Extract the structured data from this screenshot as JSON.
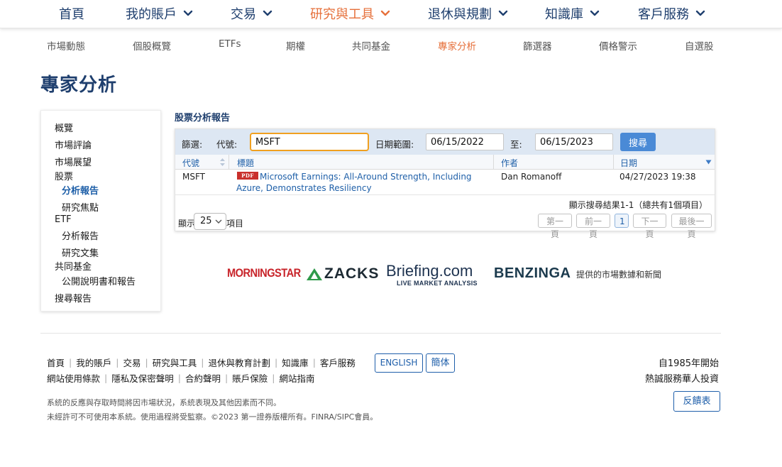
{
  "top_nav": [
    {
      "label": "首頁",
      "has_menu": false
    },
    {
      "label": "我的賬戶",
      "has_menu": true
    },
    {
      "label": "交易",
      "has_menu": true
    },
    {
      "label": "研究與工具",
      "has_menu": true,
      "active": true
    },
    {
      "label": "退休與規劃",
      "has_menu": true
    },
    {
      "label": "知識庫",
      "has_menu": true
    },
    {
      "label": "客戶服務",
      "has_menu": true
    }
  ],
  "sub_nav": [
    {
      "label": "市場動態"
    },
    {
      "label": "個股概覽"
    },
    {
      "label": "ETFs"
    },
    {
      "label": "期權"
    },
    {
      "label": "共同基金"
    },
    {
      "label": "專家分析",
      "active": true
    },
    {
      "label": "篩選器"
    },
    {
      "label": "價格警示"
    },
    {
      "label": "自選股"
    }
  ],
  "page_title": "專家分析",
  "sidebar": {
    "items": [
      {
        "label": "概覽"
      },
      {
        "label": "市場評論"
      },
      {
        "label": "市場展望"
      },
      {
        "label": "股票"
      },
      {
        "label": "分析報告",
        "active": true
      },
      {
        "label": "研究焦點"
      },
      {
        "label": "ETF"
      },
      {
        "label": "分析報告"
      },
      {
        "label": "研究文集"
      },
      {
        "label": "共同基金"
      },
      {
        "label": "公開說明書和報告"
      },
      {
        "label": "搜尋報告"
      }
    ]
  },
  "report": {
    "section_title": "股票分析報告",
    "filter": {
      "label": "篩選:",
      "symbol_label": "代號:",
      "symbol_value": "MSFT",
      "date_range_label": "日期範圍:",
      "date_from": "06/15/2022",
      "to_label": "至:",
      "date_to": "06/15/2023",
      "search_label": "搜尋"
    },
    "columns": {
      "symbol": "代號",
      "title": "標題",
      "author": "作者",
      "date": "日期"
    },
    "rows": [
      {
        "symbol": "MSFT",
        "pdf_badge": "PDF",
        "title": "Microsoft Earnings: All-Around Strength, Including Azure, Demonstrates Resiliency",
        "author": "Dan Romanoff",
        "date": "04/27/2023 19:38"
      }
    ],
    "results_info": "顯示搜尋結果1-1（總共有1個項目）",
    "show_label": "顯示",
    "page_size": "25",
    "items_label": "項目",
    "pagination": {
      "first": "第一頁",
      "prev": "前一頁",
      "current": "1",
      "next": "下一頁",
      "last": "最後一頁"
    }
  },
  "providers": {
    "morningstar": "MORNINGSTAR",
    "zacks": "ZACKS",
    "briefing": "Briefing.com",
    "briefing_sub": "LIVE MARKET ANALYSIS",
    "benzinga": "BENZINGA",
    "note": "提供的市場數據和新聞"
  },
  "footer": {
    "links_row1": [
      "首頁",
      "我的賬戶",
      "交易",
      "研究與工具",
      "退休與教育計劃",
      "知識庫",
      "客戶服務"
    ],
    "links_row2": [
      "網站使用條款",
      "隱私及保密聲明",
      "合約聲明",
      "賬戶保險",
      "網站指南"
    ],
    "lang_english": "ENGLISH",
    "lang_simplified": "簡体",
    "since_line1": "自1985年開始",
    "since_line2": "熱誠服務華人投資",
    "disclaimer1": "系統的反應與存取時間將因市場狀況，系統表現及其他因素而不同。",
    "disclaimer2": "未經許可不可使用本系統。使用過程將受監察。©2023 第一證券版權所有。FINRA/SIPC會員。",
    "feedback": "反饋表"
  },
  "colors": {
    "brand_blue": "#1f3f6e",
    "accent_orange": "#e6703b",
    "link_blue": "#1e5fa8",
    "button_blue": "#4a8ad6"
  }
}
